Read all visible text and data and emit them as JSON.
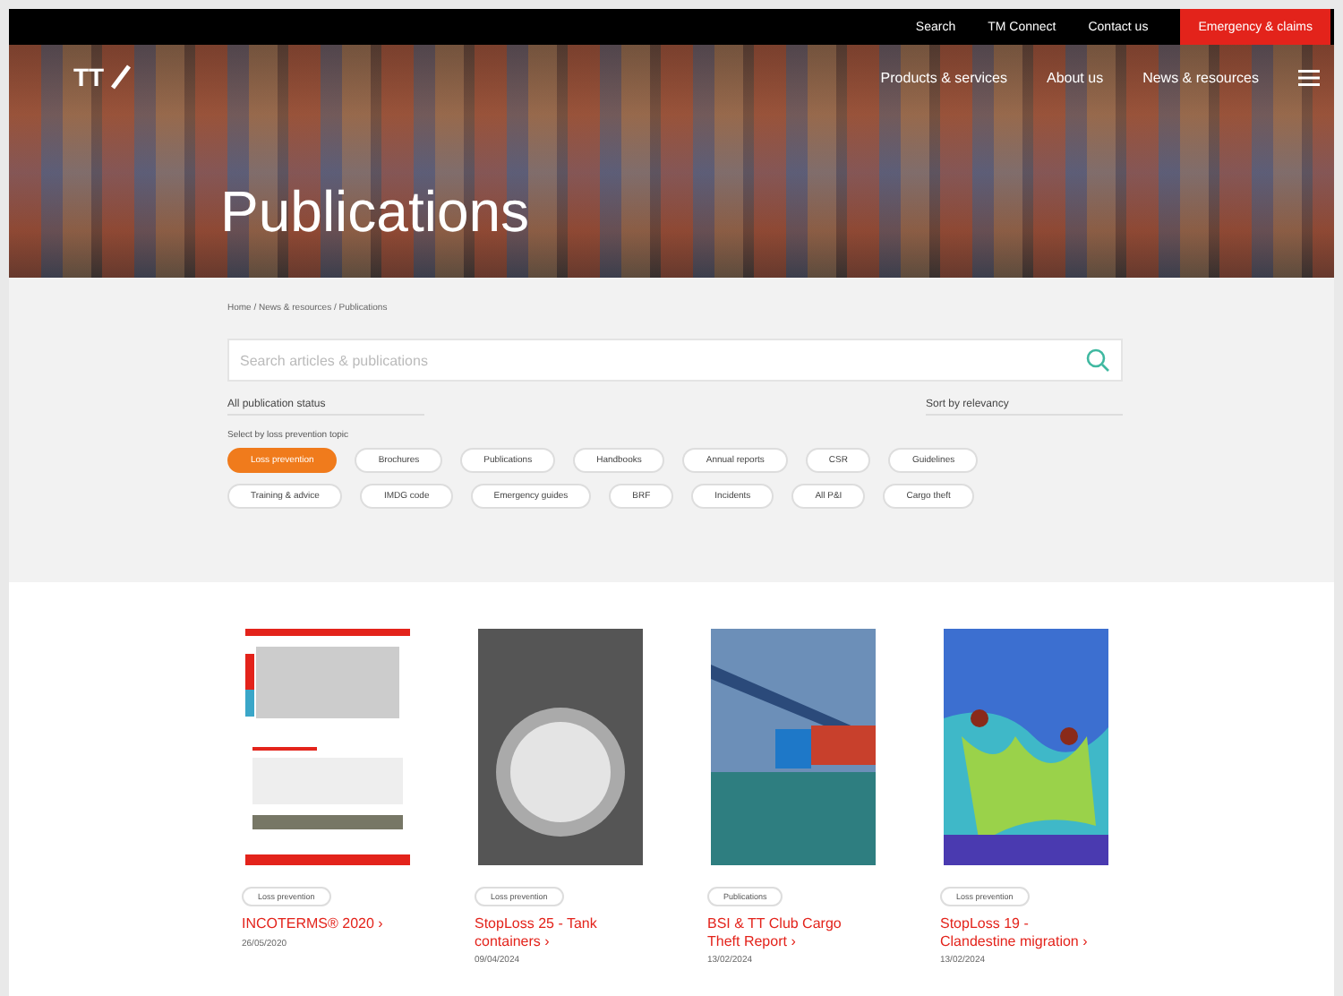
{
  "top_bar": {
    "links": [
      "Search",
      "TM Connect",
      "Contact us"
    ],
    "emergency_button": "Emergency & claims"
  },
  "header": {
    "logo": "TT",
    "nav": [
      "Products & services",
      "About us",
      "News & resources"
    ]
  },
  "hero": {
    "title": "Publications"
  },
  "breadcrumb": "Home / News & resources / Publications",
  "search": {
    "placeholder": "Search articles & publications"
  },
  "filters": {
    "status": "All publication status",
    "sort": "Sort by relevancy"
  },
  "type_label": "Select by loss prevention topic",
  "chips": [
    {
      "label": "Loss prevention",
      "selected": true
    },
    {
      "label": "Brochures",
      "selected": false
    },
    {
      "label": "Publications",
      "selected": false
    },
    {
      "label": "Handbooks",
      "selected": false
    },
    {
      "label": "Annual reports",
      "selected": false
    },
    {
      "label": "CSR",
      "selected": false
    },
    {
      "label": "Guidelines",
      "selected": false
    },
    {
      "label": "Training & advice",
      "selected": false
    },
    {
      "label": "IMDG code",
      "selected": false
    },
    {
      "label": "Emergency guides",
      "selected": false
    },
    {
      "label": "BRF",
      "selected": false
    },
    {
      "label": "Incidents",
      "selected": false
    },
    {
      "label": "All P&I",
      "selected": false
    },
    {
      "label": "Cargo theft",
      "selected": false
    }
  ],
  "cards": [
    {
      "kind": "document",
      "tag": "Loss prevention",
      "title": "INCOTERMS® 2020 ›",
      "date": "26/05/2020"
    },
    {
      "kind": "tank",
      "tag": "Loss prevention",
      "title": "StopLoss 25 - Tank containers ›",
      "date": "09/04/2024"
    },
    {
      "kind": "truck",
      "tag": "Publications",
      "title": "BSI & TT Club Cargo Theft Report ›",
      "date": "13/02/2024"
    },
    {
      "kind": "heatmap",
      "tag": "Loss prevention",
      "title": "StopLoss 19 - Clandestine migration ›",
      "date": "13/02/2024"
    }
  ]
}
